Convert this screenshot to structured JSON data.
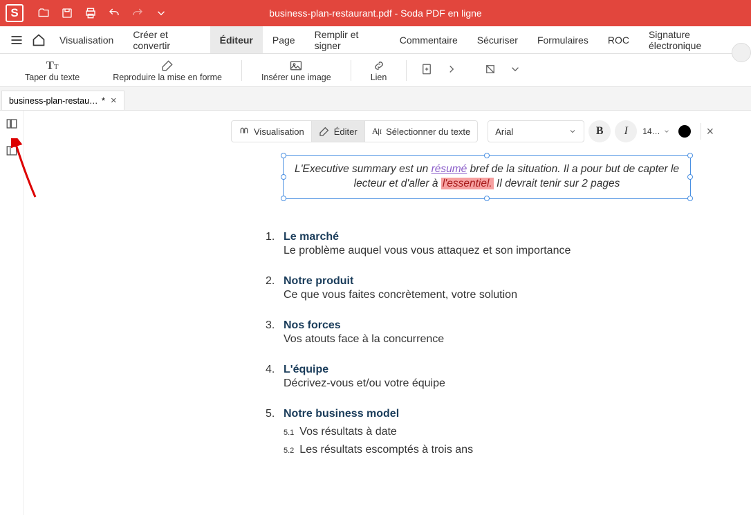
{
  "app": {
    "title": "business-plan-restaurant.pdf - Soda PDF en ligne",
    "logo_letter": "S"
  },
  "menu": {
    "items": [
      "Visualisation",
      "Créer et convertir",
      "Éditeur",
      "Page",
      "Remplir et signer",
      "Commentaire",
      "Sécuriser",
      "Formulaires",
      "ROC",
      "Signature électronique"
    ],
    "active_index": 2
  },
  "ribbon": {
    "type_text": "Taper du texte",
    "cloner": "Reproduire la mise en forme",
    "image": "Insérer une image",
    "link": "Lien"
  },
  "tab": {
    "label": "business-plan-restaura…",
    "dirty_marker": "*"
  },
  "float_tb": {
    "visual": "Visualisation",
    "edit": "Éditer",
    "select": "Sélectionner du texte",
    "font": "Arial",
    "bold": "B",
    "italic": "I",
    "size": "14…",
    "close": "×"
  },
  "selection": {
    "pre1": "L'Executive summary est un ",
    "purple": "résumé",
    "mid1": " bref de la situation. Il a pour but de capter le lecteur et d'aller à ",
    "red": "l'essentiel.",
    "post1": " Il devrait tenir sur 2 pages"
  },
  "outline": {
    "items": [
      {
        "num": "1.",
        "title": "Le marché",
        "desc": "Le problème auquel vous vous attaquez et son importance"
      },
      {
        "num": "2.",
        "title": "Notre produit",
        "desc": "Ce que vous faites concrètement, votre solution"
      },
      {
        "num": "3.",
        "title": "Nos forces",
        "desc": "Vos atouts face à la concurrence"
      },
      {
        "num": "4.",
        "title": "L'équipe",
        "desc": "Décrivez-vous et/ou votre équipe"
      },
      {
        "num": "5.",
        "title": "Notre business model",
        "subs": [
          {
            "snum": "5.1",
            "text": "Vos résultats à date"
          },
          {
            "snum": "5.2",
            "text": "Les résultats escomptés à trois ans"
          }
        ]
      }
    ]
  }
}
